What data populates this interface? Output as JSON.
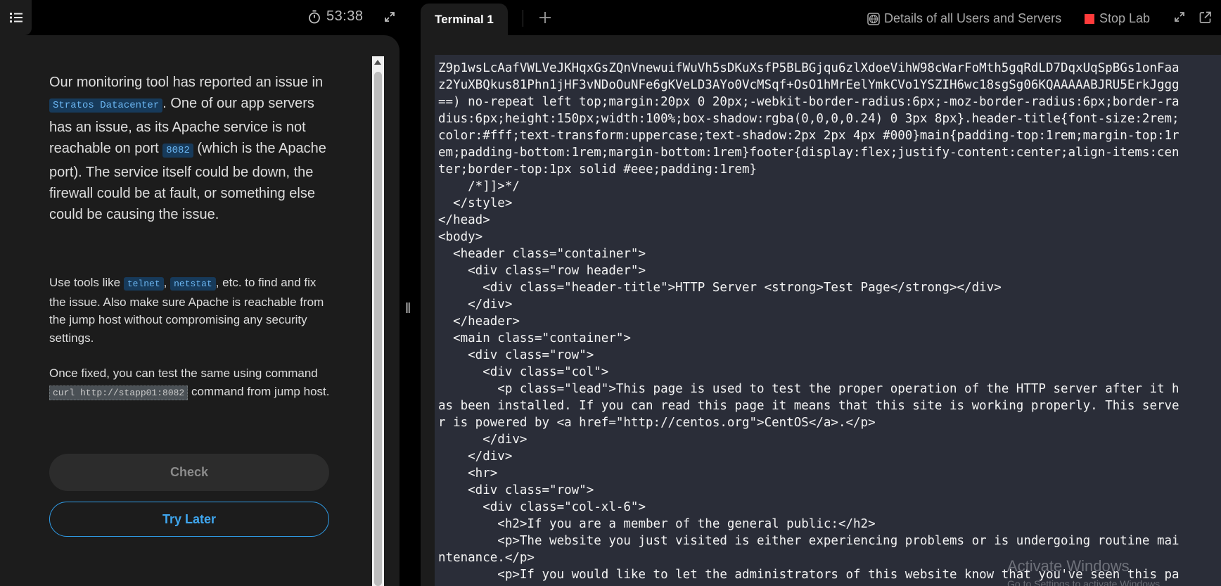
{
  "left_panel": {
    "timer": "53:38",
    "paragraph1": {
      "t1": "Our monitoring tool has reported an issue in ",
      "code1": "Stratos Datacenter",
      "t2": ". One of our app servers has an issue, as its Apache service is not reachable on port ",
      "code2": "8082",
      "t3": " (which is the Apache port). The service itself could be down, the firewall could be at fault, or something else could be causing the issue."
    },
    "paragraph2": {
      "t1": "Use tools like ",
      "code1": "telnet",
      "t2": ", ",
      "code2": "netstat",
      "t3": ", etc. to find and fix the issue. Also make sure Apache is reachable from the jump host without compromising any security settings."
    },
    "paragraph3": {
      "t1": "Once fixed, you can test the same using command ",
      "code1": "curl http://stapp01:8082",
      "t2": " command from jump host."
    },
    "check_label": "Check",
    "try_later_label": "Try Later"
  },
  "tabs": [
    {
      "label": "Terminal 1",
      "active": true
    }
  ],
  "toolbar": {
    "details_label": "Details of all Users and Servers",
    "stop_lab_label": "Stop Lab"
  },
  "terminal_lines": [
    "Z9p1wsLcAafVWLVeJKHqxGsZQnVnewuifWuVh5sDKuXsfP5BLBGjqu6zlXdoeVihW98cWarFoMth5gqRdLD7DqxUqSpBGs1onFaa",
    "z2YuXBQkus81Phn1jHF3vNDoOuNFe6gKVeLD3AYo0VcMSqf+OsO1hMrEelYmkCVo1YSZIH6wc18sgSg06KQAAAAABJRU5ErkJggg",
    "==) no-repeat left top;margin:20px 0 20px;-webkit-border-radius:6px;-moz-border-radius:6px;border-ra",
    "dius:6px;height:150px;width:100%;box-shadow:rgba(0,0,0,0.24) 0 3px 8px}.header-title{font-size:2rem;",
    "color:#fff;text-transform:uppercase;text-shadow:2px 2px 4px #000}main{padding-top:1rem;margin-top:1r",
    "em;padding-bottom:1rem;margin-bottom:1rem}footer{display:flex;justify-content:center;align-items:cen",
    "ter;border-top:1px solid #eee;padding:1rem}",
    "    /*]]>*/",
    "  </style>",
    "</head>",
    "<body>",
    "  <header class=\"container\">",
    "    <div class=\"row header\">",
    "      <div class=\"header-title\">HTTP Server <strong>Test Page</strong></div>",
    "    </div>",
    "  </header>",
    "  <main class=\"container\">",
    "    <div class=\"row\">",
    "      <div class=\"col\">",
    "        <p class=\"lead\">This page is used to test the proper operation of the HTTP server after it h",
    "as been installed. If you can read this page it means that this site is working properly. This serve",
    "r is powered by <a href=\"http://centos.org\">CentOS</a>.</p>",
    "      </div>",
    "    </div>",
    "    <hr>",
    "    <div class=\"row\">",
    "      <div class=\"col-xl-6\">",
    "        <h2>If you are a member of the general public:</h2>",
    "        <p>The website you just visited is either experiencing problems or is undergoing routine mai",
    "ntenance.</p>",
    "        <p>If you would like to let the administrators of this website know that you've seen this pa"
  ],
  "watermark": {
    "title": "Activate Windows",
    "subtitle": "Go to Settings to activate Windows."
  }
}
